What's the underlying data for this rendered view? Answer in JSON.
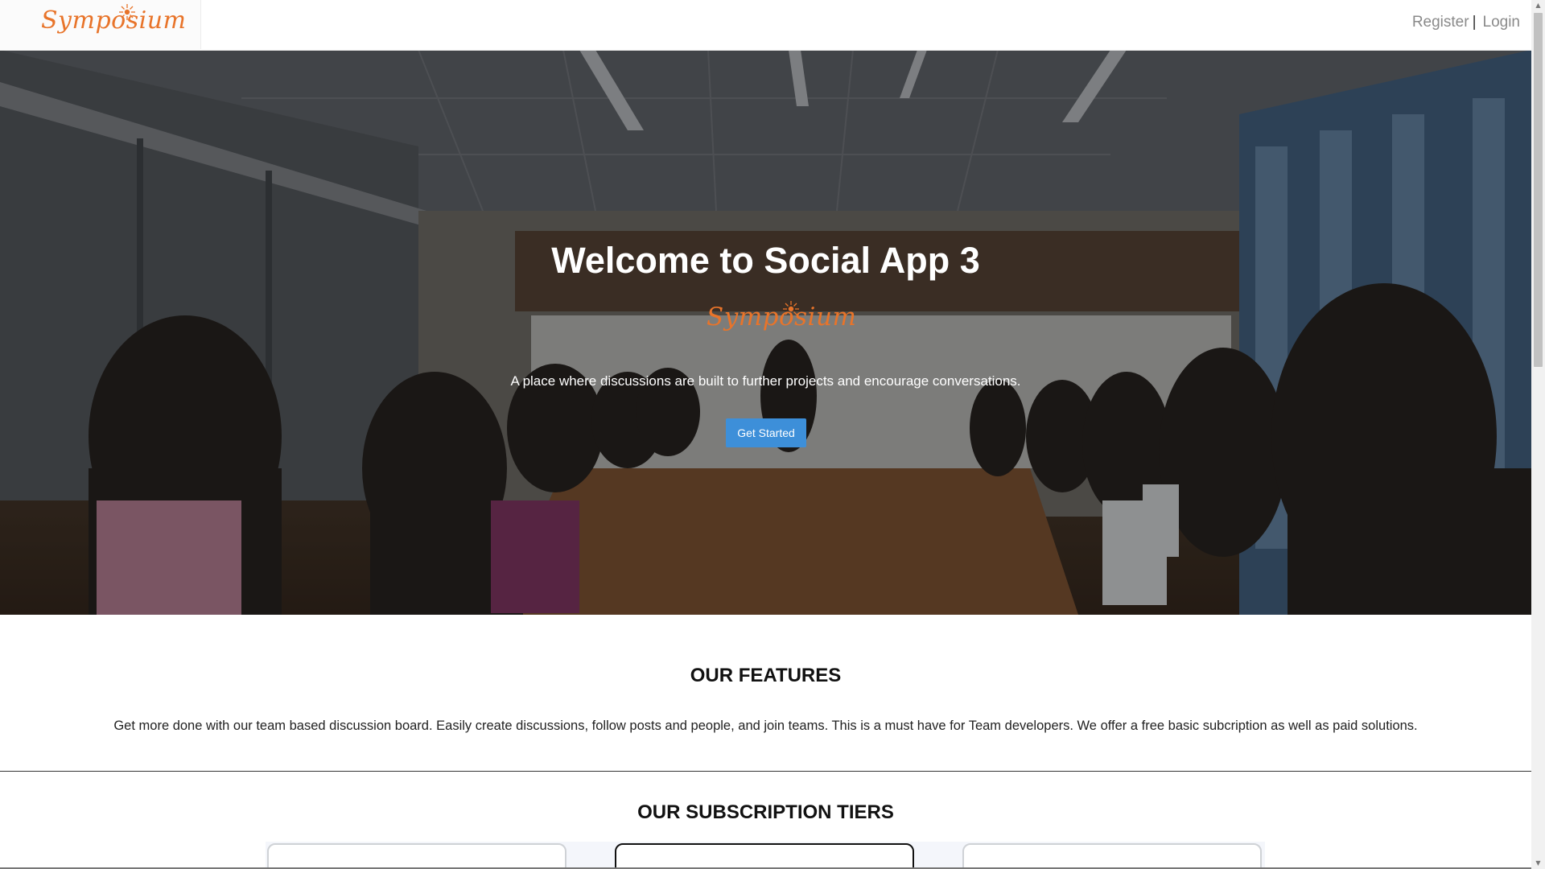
{
  "header": {
    "brand": "Symposium",
    "nav": {
      "register": "Register",
      "separator": "|",
      "login": "Login"
    }
  },
  "hero": {
    "title": "Welcome to Social App 3",
    "logo": "Symposium",
    "tagline": "A place where discussions are built to further projects and encourage conversations.",
    "cta_label": "Get Started"
  },
  "features": {
    "title": "OUR FEATURES",
    "text": "Get more done with our team based discussion board. Easily create discussions, follow posts and people, and join teams. This is a must have for Team developers. We offer a free basic subcription as well as paid solutions."
  },
  "tiers": {
    "title": "OUR SUBSCRIPTION TIERS"
  },
  "colors": {
    "brand": "#e8742a",
    "accent": "#3d8fd9"
  },
  "icons": {
    "scroll_up": "scroll-up-arrow-icon",
    "scroll_down": "scroll-down-arrow-icon"
  }
}
